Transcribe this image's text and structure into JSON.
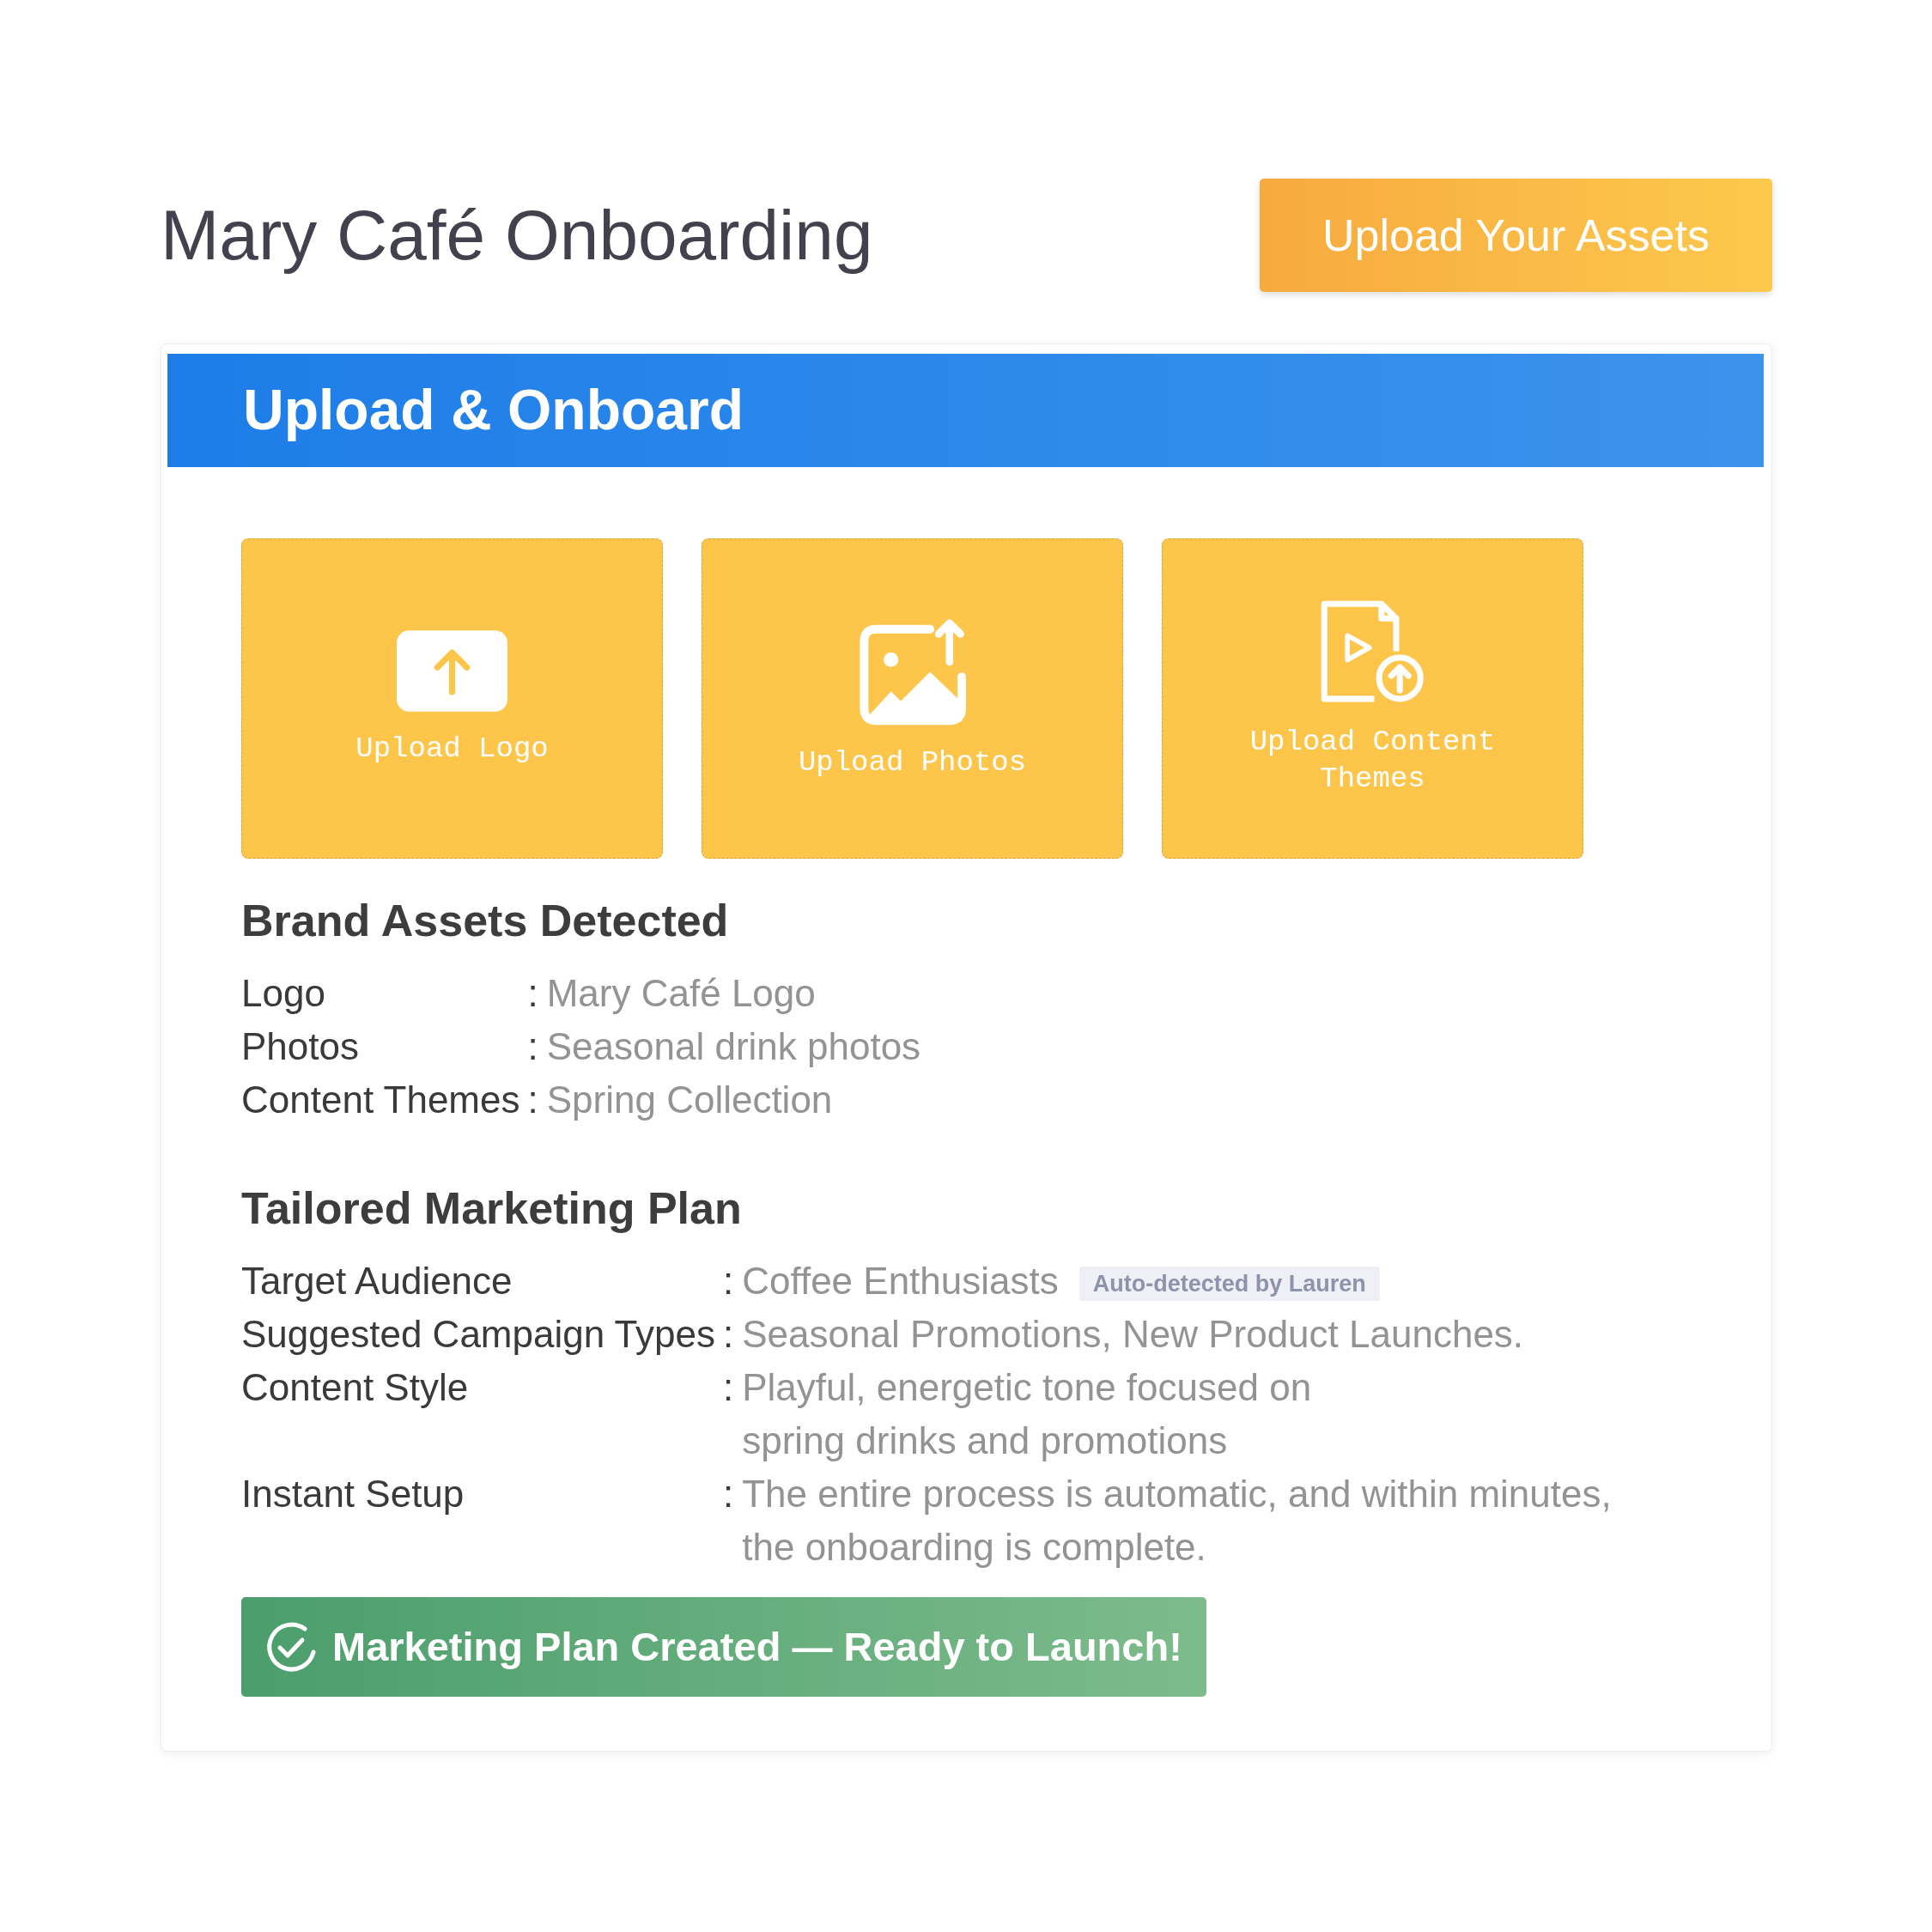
{
  "header": {
    "title": "Mary Café Onboarding",
    "upload_button": "Upload Your Assets"
  },
  "panel": {
    "title": "Upload & Onboard",
    "upload_tiles": [
      {
        "kind": "logo",
        "label": "Upload Logo"
      },
      {
        "kind": "photos",
        "label": "Upload Photos"
      },
      {
        "kind": "content",
        "label": "Upload Content Themes"
      }
    ],
    "brand_assets": {
      "title": "Brand Assets Detected",
      "rows": [
        {
          "label": "Logo",
          "separator": ":",
          "value": "Mary Café Logo"
        },
        {
          "label": "Photos",
          "separator": ":",
          "value": "Seasonal drink photos"
        },
        {
          "label": "Content Themes",
          "separator": ":",
          "value": "Spring Collection"
        }
      ]
    },
    "marketing_plan": {
      "title": "Tailored Marketing Plan",
      "rows": [
        {
          "label": "Target Audience",
          "separator": ":",
          "value": "Coffee Enthusiasts",
          "badge": "Auto-detected by Lauren"
        },
        {
          "label": "Suggested Campaign Types",
          "separator": ":",
          "value": "Seasonal Promotions, New Product Launches."
        },
        {
          "label": "Content Style",
          "separator": ":",
          "value": "Playful, energetic tone focused on\nspring drinks and promotions"
        },
        {
          "label": "Instant Setup",
          "separator": ":",
          "value": "The entire process is automatic, and within minutes,\nthe onboarding is complete."
        }
      ]
    },
    "status_banner": {
      "text": "Marketing Plan Created — Ready to Launch!"
    }
  }
}
